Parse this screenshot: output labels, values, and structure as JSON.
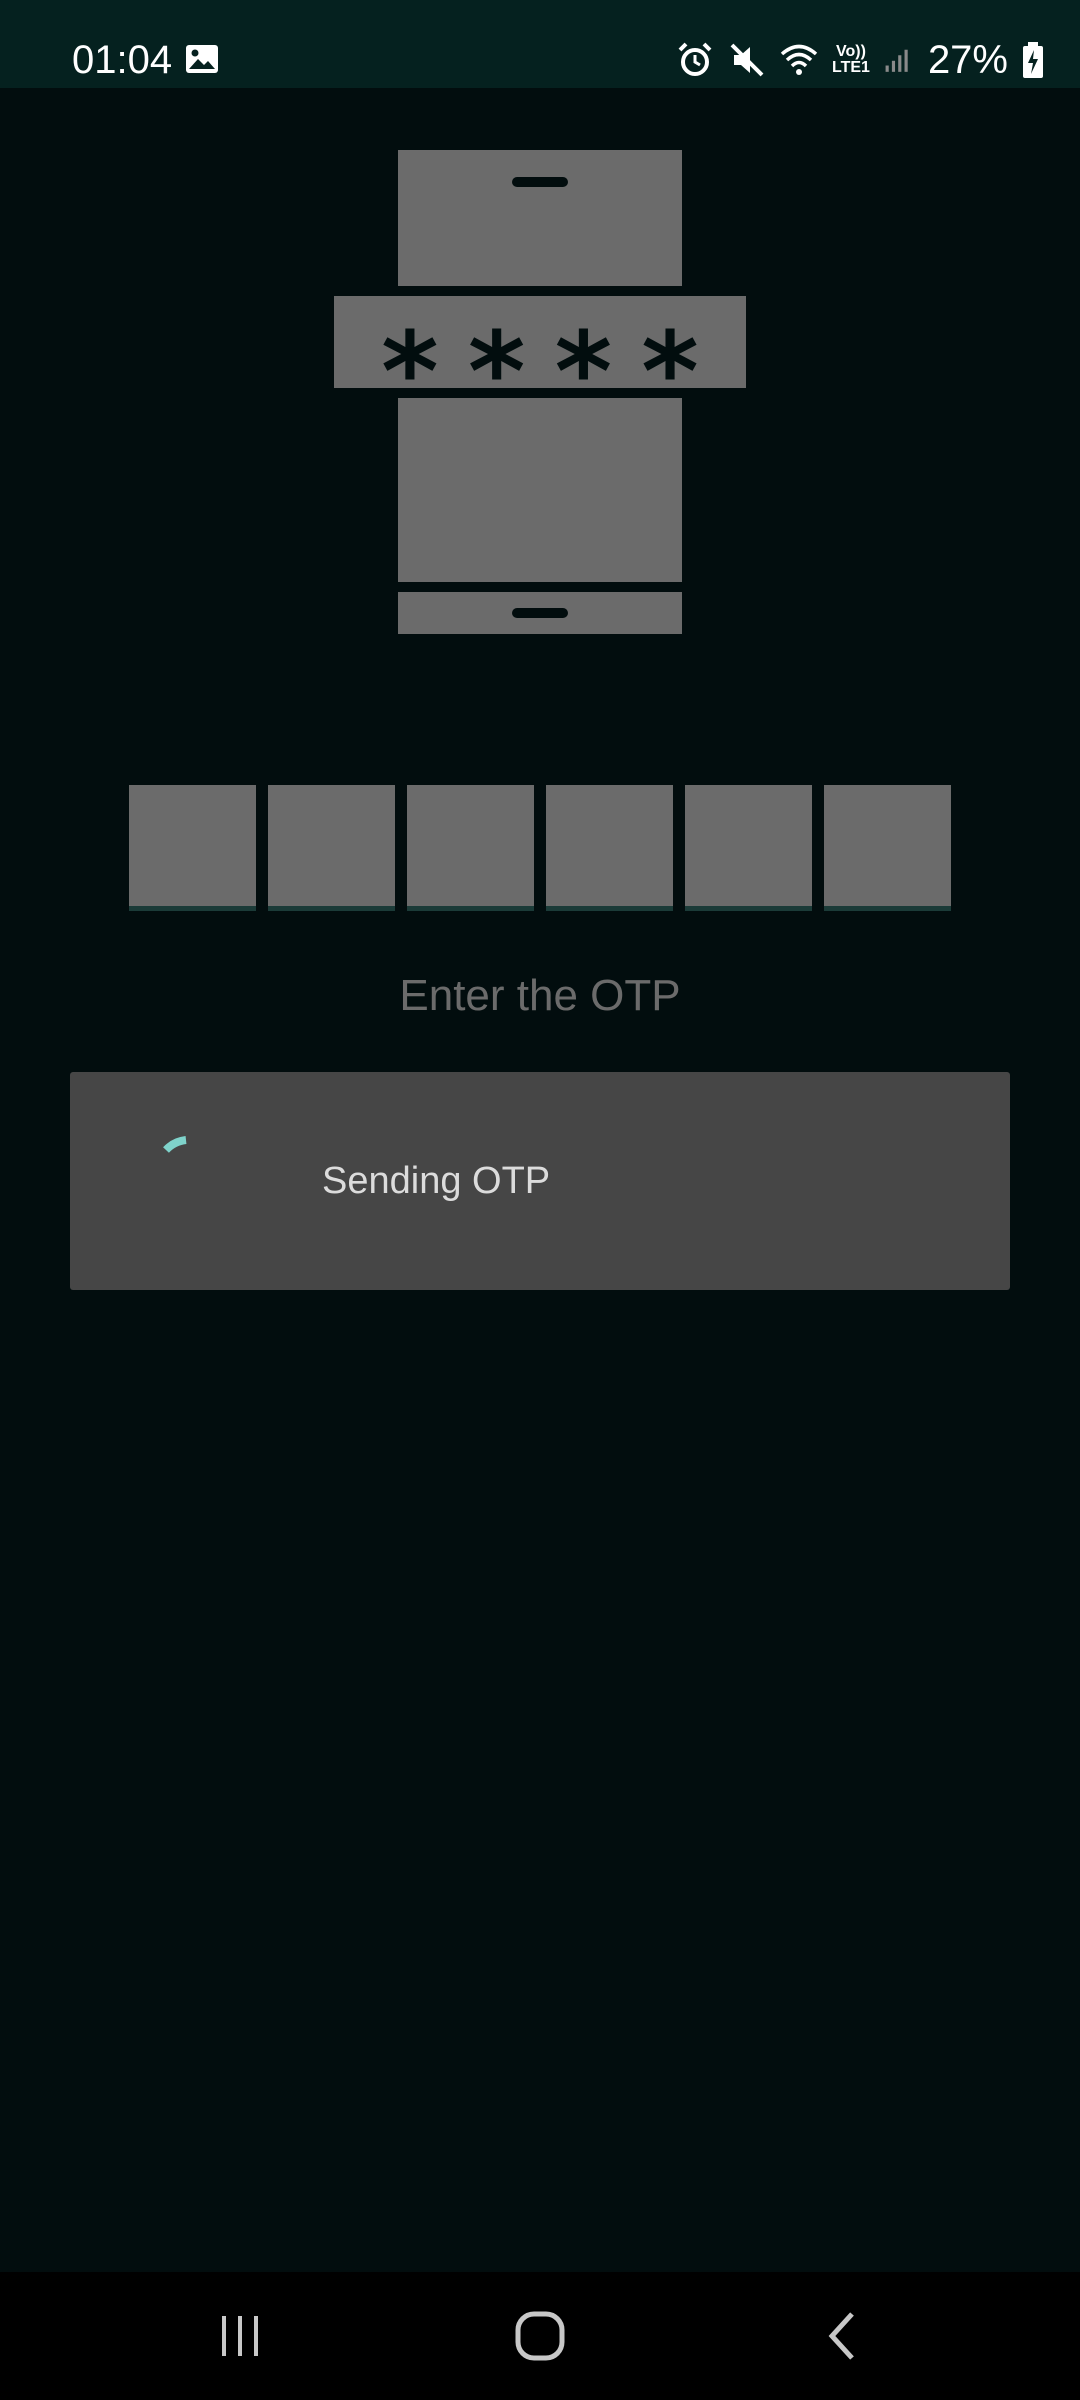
{
  "status_bar": {
    "time": "01:04",
    "battery": "27%",
    "network_label_top": "Vo))",
    "network_label_bottom": "LTE1",
    "icons": [
      "gallery-icon",
      "alarm-icon",
      "mute-icon",
      "wifi-icon",
      "lte-icon",
      "signal-icon",
      "battery-charging-icon"
    ]
  },
  "illustration": {
    "pin_chars": [
      "*",
      "*",
      "*",
      "*"
    ]
  },
  "otp": {
    "digit_count": 6,
    "digits": [
      "",
      "",
      "",
      "",
      "",
      ""
    ],
    "prompt": "Enter the OTP"
  },
  "dialog": {
    "message": "Sending OTP",
    "spinner_color": "#7fd3cb"
  },
  "nav_bar": {
    "icons": [
      "recents-icon",
      "home-icon",
      "back-icon"
    ]
  },
  "colors": {
    "background": "#020d0e",
    "status_bar": "#05211f",
    "placeholder_gray": "#6b6b6b",
    "dialog": "#464646"
  }
}
